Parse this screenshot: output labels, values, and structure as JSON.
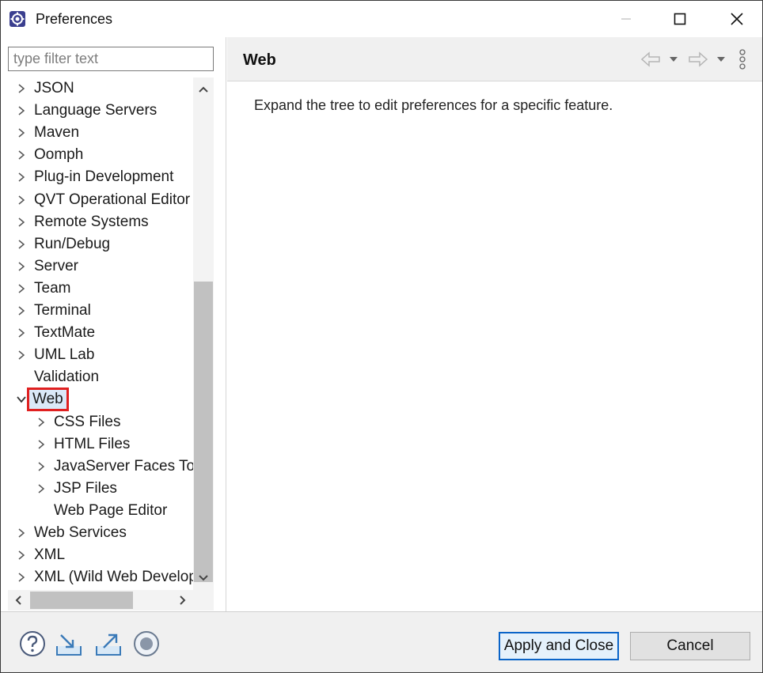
{
  "window": {
    "title": "Preferences"
  },
  "filter": {
    "placeholder": "type filter text",
    "value": ""
  },
  "tree": {
    "items": [
      {
        "label": "JSON",
        "level": 0,
        "chevron": "collapsed"
      },
      {
        "label": "Language Servers",
        "level": 0,
        "chevron": "collapsed"
      },
      {
        "label": "Maven",
        "level": 0,
        "chevron": "collapsed"
      },
      {
        "label": "Oomph",
        "level": 0,
        "chevron": "collapsed"
      },
      {
        "label": "Plug-in Development",
        "level": 0,
        "chevron": "collapsed"
      },
      {
        "label": "QVT Operational Editor",
        "level": 0,
        "chevron": "collapsed"
      },
      {
        "label": "Remote Systems",
        "level": 0,
        "chevron": "collapsed"
      },
      {
        "label": "Run/Debug",
        "level": 0,
        "chevron": "collapsed"
      },
      {
        "label": "Server",
        "level": 0,
        "chevron": "collapsed"
      },
      {
        "label": "Team",
        "level": 0,
        "chevron": "collapsed"
      },
      {
        "label": "Terminal",
        "level": 0,
        "chevron": "collapsed"
      },
      {
        "label": "TextMate",
        "level": 0,
        "chevron": "collapsed"
      },
      {
        "label": "UML Lab",
        "level": 0,
        "chevron": "collapsed"
      },
      {
        "label": "Validation",
        "level": 0,
        "chevron": "none"
      },
      {
        "label": "Web",
        "level": 0,
        "chevron": "expanded",
        "selected": true
      },
      {
        "label": "CSS Files",
        "level": 1,
        "chevron": "collapsed"
      },
      {
        "label": "HTML Files",
        "level": 1,
        "chevron": "collapsed"
      },
      {
        "label": "JavaServer Faces Tools",
        "level": 1,
        "chevron": "collapsed"
      },
      {
        "label": "JSP Files",
        "level": 1,
        "chevron": "collapsed"
      },
      {
        "label": "Web Page Editor",
        "level": 1,
        "chevron": "none"
      },
      {
        "label": "Web Services",
        "level": 0,
        "chevron": "collapsed"
      },
      {
        "label": "XML",
        "level": 0,
        "chevron": "collapsed"
      },
      {
        "label": "XML (Wild Web Developer)",
        "level": 0,
        "chevron": "collapsed"
      }
    ]
  },
  "page": {
    "title": "Web",
    "description": "Expand the tree to edit preferences for a specific feature."
  },
  "buttons": {
    "apply_close": "Apply and Close",
    "cancel": "Cancel"
  },
  "icons": {
    "app": "eclipse-gear-icon",
    "help": "help-icon",
    "import": "import-icon",
    "export": "export-icon",
    "record": "record-icon"
  },
  "colors": {
    "selection_border": "#e02020",
    "selection_fill": "#dbe9f8",
    "default_button_border": "#0a64c8"
  }
}
